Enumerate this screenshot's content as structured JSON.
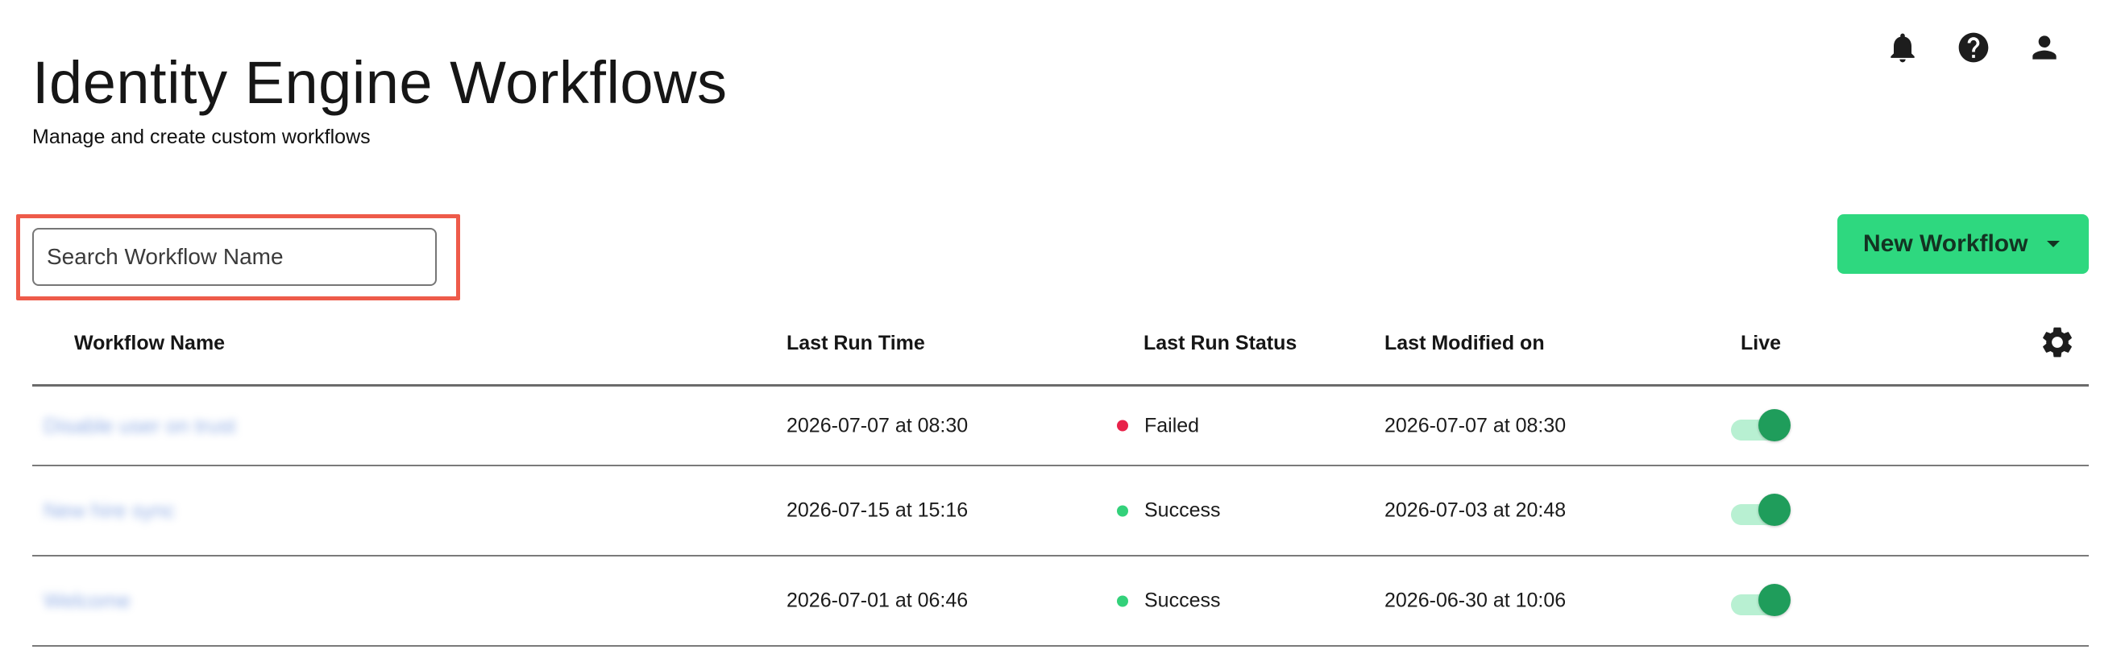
{
  "header": {
    "title": "Identity Engine Workflows",
    "subtitle": "Manage and create custom workflows"
  },
  "top_icons": [
    "bell-icon",
    "help-icon",
    "user-icon"
  ],
  "search": {
    "placeholder": "Search Workflow Name",
    "value": ""
  },
  "new_workflow_button": {
    "label": "New Workflow"
  },
  "table": {
    "columns": {
      "name": "Workflow Name",
      "time": "Last Run Time",
      "status": "Last Run Status",
      "modified": "Last Modified on",
      "live": "Live"
    },
    "rows": [
      {
        "name": "Disable user on trust",
        "last_run_time": "2026-07-07 at 08:30",
        "last_run_status": "Failed",
        "status_color": "#e8224a",
        "last_modified": "2026-07-07 at 08:30",
        "live": true
      },
      {
        "name": "New hire sync",
        "last_run_time": "2026-07-15 at 15:16",
        "last_run_status": "Success",
        "status_color": "#33d17a",
        "last_modified": "2026-07-03 at 20:48",
        "live": true
      },
      {
        "name": "Welcome",
        "last_run_time": "2026-07-01 at 06:46",
        "last_run_status": "Success",
        "status_color": "#33d17a",
        "last_modified": "2026-06-30 at 10:06",
        "live": true
      }
    ]
  },
  "colors": {
    "accent": "#2ed87f",
    "highlight": "#ee5b4a",
    "toggle_on": "#1f9d5b"
  }
}
